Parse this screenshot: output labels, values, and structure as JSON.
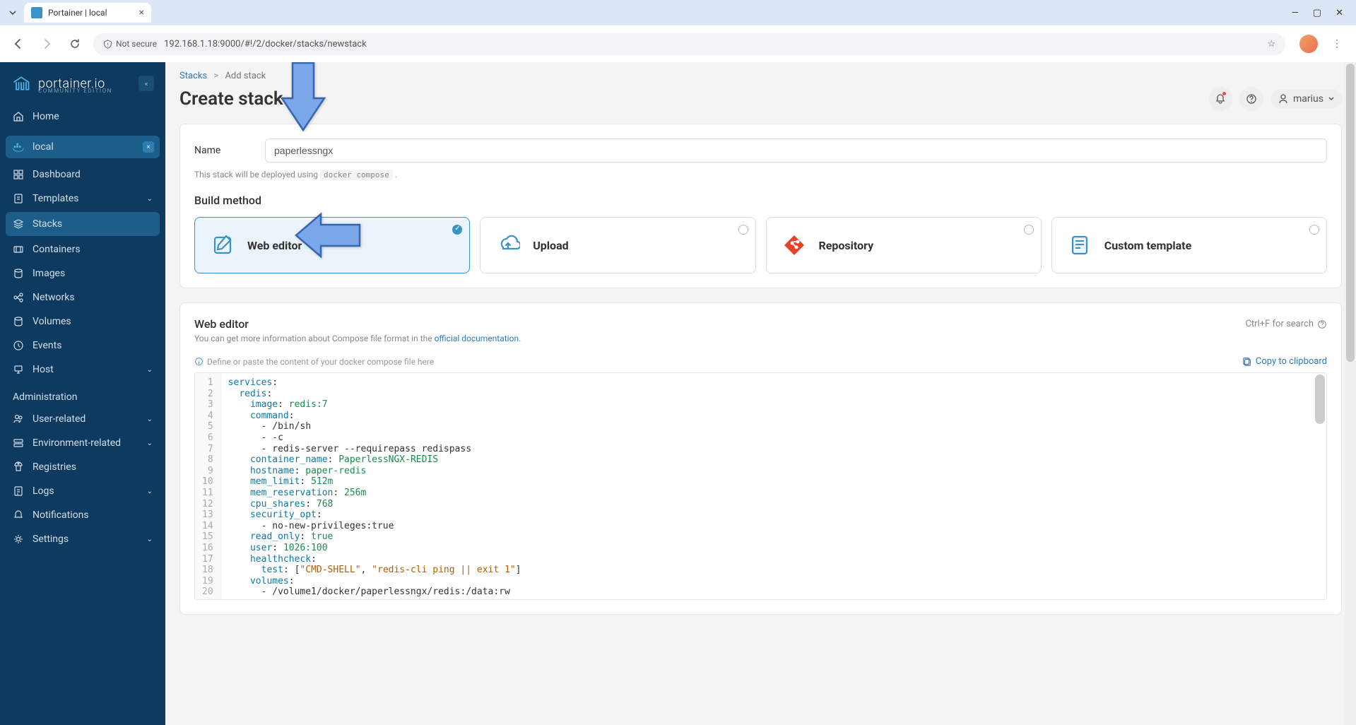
{
  "browser": {
    "tab_title": "Portainer | local",
    "not_secure": "Not secure",
    "url": "192.168.1.18:9000/#!/2/docker/stacks/newstack"
  },
  "sidebar": {
    "logo_text": "portainer.io",
    "logo_sub": "COMMUNITY EDITION",
    "home": "Home",
    "env_label": "local",
    "items": [
      {
        "label": "Dashboard"
      },
      {
        "label": "Templates"
      },
      {
        "label": "Stacks"
      },
      {
        "label": "Containers"
      },
      {
        "label": "Images"
      },
      {
        "label": "Networks"
      },
      {
        "label": "Volumes"
      },
      {
        "label": "Events"
      },
      {
        "label": "Host"
      }
    ],
    "admin_title": "Administration",
    "admin_items": [
      {
        "label": "User-related"
      },
      {
        "label": "Environment-related"
      },
      {
        "label": "Registries"
      },
      {
        "label": "Logs"
      },
      {
        "label": "Notifications"
      },
      {
        "label": "Settings"
      }
    ]
  },
  "breadcrumb": {
    "root": "Stacks",
    "current": "Add stack"
  },
  "page_title": "Create stack",
  "user": "marius",
  "form": {
    "name_label": "Name",
    "name_value": "paperlessngx",
    "helper_pre": "This stack will be deployed using",
    "helper_code": "docker compose",
    "helper_post": "."
  },
  "build": {
    "title": "Build method",
    "methods": [
      {
        "label": "Web editor"
      },
      {
        "label": "Upload"
      },
      {
        "label": "Repository"
      },
      {
        "label": "Custom template"
      }
    ]
  },
  "editor": {
    "title": "Web editor",
    "shortcut": "Ctrl+F for search",
    "info_pre": "You can get more information about Compose file format in the ",
    "info_link": "official documentation",
    "hint": "Define or paste the content of your docker compose file here",
    "copy": "Copy to clipboard"
  },
  "code_lines": [
    {
      "n": 1,
      "tokens": [
        [
          "kw",
          "services"
        ],
        [
          "",
          ":"
        ]
      ]
    },
    {
      "n": 2,
      "tokens": [
        [
          "",
          "  "
        ],
        [
          "kw",
          "redis"
        ],
        [
          "",
          ":"
        ]
      ]
    },
    {
      "n": 3,
      "tokens": [
        [
          "",
          "    "
        ],
        [
          "kw",
          "image"
        ],
        [
          "",
          ": "
        ],
        [
          "val",
          "redis:7"
        ]
      ]
    },
    {
      "n": 4,
      "tokens": [
        [
          "",
          "    "
        ],
        [
          "kw",
          "command"
        ],
        [
          "",
          ":"
        ]
      ]
    },
    {
      "n": 5,
      "tokens": [
        [
          "",
          "      - /bin/sh"
        ]
      ]
    },
    {
      "n": 6,
      "tokens": [
        [
          "",
          "      - -c"
        ]
      ]
    },
    {
      "n": 7,
      "tokens": [
        [
          "",
          "      - redis-server --requirepass redispass"
        ]
      ]
    },
    {
      "n": 8,
      "tokens": [
        [
          "",
          "    "
        ],
        [
          "kw",
          "container_name"
        ],
        [
          "",
          ": "
        ],
        [
          "val",
          "PaperlessNGX-REDIS"
        ]
      ]
    },
    {
      "n": 9,
      "tokens": [
        [
          "",
          "    "
        ],
        [
          "kw",
          "hostname"
        ],
        [
          "",
          ": "
        ],
        [
          "val",
          "paper-redis"
        ]
      ]
    },
    {
      "n": 10,
      "tokens": [
        [
          "",
          "    "
        ],
        [
          "kw",
          "mem_limit"
        ],
        [
          "",
          ": "
        ],
        [
          "val",
          "512m"
        ]
      ]
    },
    {
      "n": 11,
      "tokens": [
        [
          "",
          "    "
        ],
        [
          "kw",
          "mem_reservation"
        ],
        [
          "",
          ": "
        ],
        [
          "val",
          "256m"
        ]
      ]
    },
    {
      "n": 12,
      "tokens": [
        [
          "",
          "    "
        ],
        [
          "kw",
          "cpu_shares"
        ],
        [
          "",
          ": "
        ],
        [
          "val",
          "768"
        ]
      ]
    },
    {
      "n": 13,
      "tokens": [
        [
          "",
          "    "
        ],
        [
          "kw",
          "security_opt"
        ],
        [
          "",
          ":"
        ]
      ]
    },
    {
      "n": 14,
      "tokens": [
        [
          "",
          "      - no-new-privileges:true"
        ]
      ]
    },
    {
      "n": 15,
      "tokens": [
        [
          "",
          "    "
        ],
        [
          "kw",
          "read_only"
        ],
        [
          "",
          ": "
        ],
        [
          "bool",
          "true"
        ]
      ]
    },
    {
      "n": 16,
      "tokens": [
        [
          "",
          "    "
        ],
        [
          "kw",
          "user"
        ],
        [
          "",
          ": "
        ],
        [
          "val",
          "1026:100"
        ]
      ]
    },
    {
      "n": 17,
      "tokens": [
        [
          "",
          "    "
        ],
        [
          "kw",
          "healthcheck"
        ],
        [
          "",
          ":"
        ]
      ]
    },
    {
      "n": 18,
      "tokens": [
        [
          "",
          "      "
        ],
        [
          "kw",
          "test"
        ],
        [
          "",
          ": ["
        ],
        [
          "str",
          "\"CMD-SHELL\""
        ],
        [
          "",
          ", "
        ],
        [
          "str",
          "\"redis-cli ping || exit 1\""
        ],
        [
          "",
          "]"
        ]
      ]
    },
    {
      "n": 19,
      "tokens": [
        [
          "",
          "    "
        ],
        [
          "kw",
          "volumes"
        ],
        [
          "",
          ":"
        ]
      ]
    },
    {
      "n": 20,
      "tokens": [
        [
          "",
          "      - /volume1/docker/paperlessngx/redis:/data:rw"
        ]
      ]
    }
  ]
}
